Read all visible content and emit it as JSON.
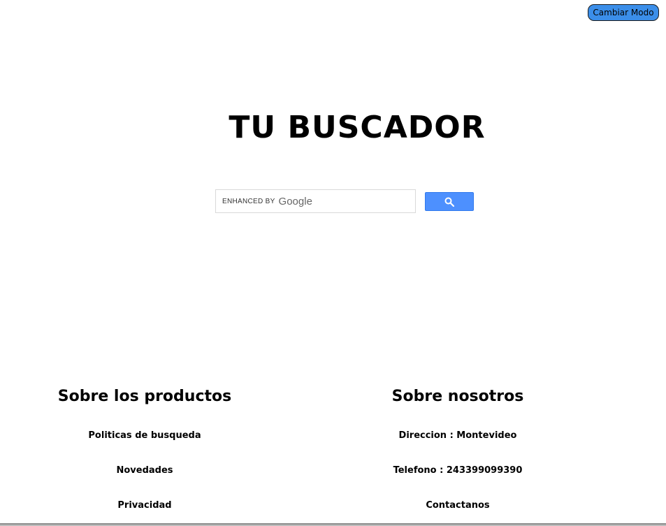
{
  "header": {
    "mode_button_label": "Cambiar Modo",
    "title": "TU BUSCADOR"
  },
  "search": {
    "enhanced_by": "ENHANCED BY",
    "brand": "Google",
    "button_icon": "search-icon",
    "button_color": "#4d90fe"
  },
  "footer": {
    "products": {
      "heading": "Sobre los productos",
      "items": [
        "Politicas de busqueda",
        "Novedades",
        "Privacidad"
      ]
    },
    "about": {
      "heading": "Sobre nosotros",
      "items": [
        "Direccion : Montevideo",
        "Telefono : 243399099390",
        "Contactanos"
      ]
    }
  },
  "colors": {
    "mode_button": "#3b8ee9",
    "background": "#ffffff",
    "text": "#000000"
  }
}
